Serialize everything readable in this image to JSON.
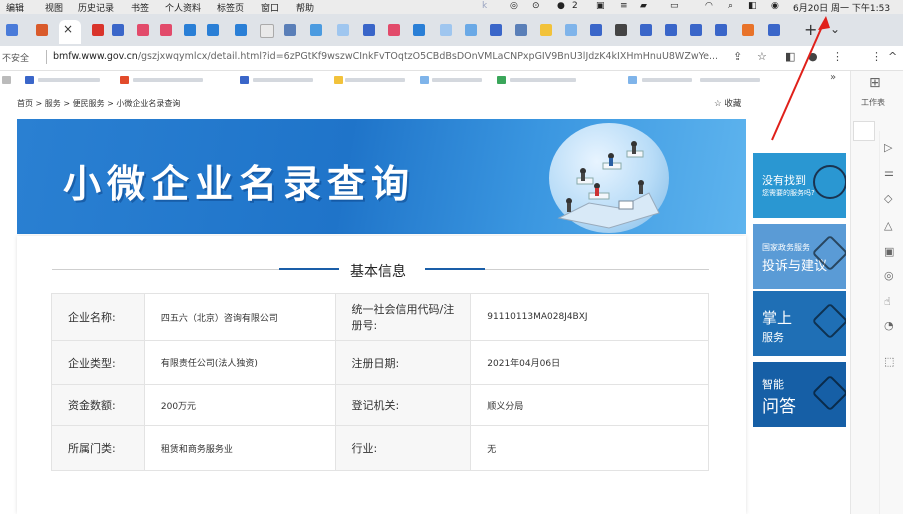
{
  "menubar": {
    "items": [
      "编辑",
      "视图",
      "历史记录",
      "书签",
      "个人资料",
      "标签页",
      "窗口",
      "帮助"
    ],
    "status_count": "2",
    "datetime": "6月20日 周一 下午1:53"
  },
  "tabs": {
    "close_glyph": "×",
    "new_tab_glyph": "+",
    "menu_glyph": "⌄"
  },
  "address": {
    "secure_label": "不安全",
    "domain": "bmfw.www.gov.cn",
    "path": "/gszjxwqymlcx/detail.html?id=6zPGtKf9wszwCInkFvTOqtzO5CBdBsDOnVMLaCNPxpGIV9BnU3lJdzK4kIXHmHnuU8WZwYe...",
    "share_icon": "share-icon",
    "star_glyph": "☆"
  },
  "sidepanel": {
    "label": "工作表"
  },
  "page": {
    "breadcrumb": "首页 > 服务 > 便民服务 > 小微企业名录查询",
    "favorite": "☆ 收藏",
    "banner_title": "小微企业名录查询",
    "section_title": "基本信息",
    "rows": [
      {
        "l1": "企业名称:",
        "v1": "四五六（北京）咨询有限公司",
        "l2": "统一社会信用代码/注册号:",
        "v2": "91110113MA028J4BXJ"
      },
      {
        "l1": "企业类型:",
        "v1": "有限责任公司(法人独资)",
        "l2": "注册日期:",
        "v2": "2021年04月06日"
      },
      {
        "l1": "资金数额:",
        "v1": "200万元",
        "l2": "登记机关:",
        "v2": "顺义分局"
      },
      {
        "l1": "所属门类:",
        "v1": "租赁和商务服务业",
        "l2": "行业:",
        "v2": "无"
      }
    ]
  },
  "tiles": [
    {
      "big": "没有找到",
      "small": "您需要的服务吗?",
      "color": "#2a97d2"
    },
    {
      "small": "国家政务服务",
      "big": "投诉与建议",
      "color": "#5a9bd6"
    },
    {
      "big": "掌上",
      "small": "服务",
      "color": "#1f6fb5"
    },
    {
      "small": "智能",
      "big": "问答",
      "color": "#165fa6"
    }
  ],
  "colors": {
    "accent": "#1a5ea8",
    "annotation": "#e0201a"
  }
}
